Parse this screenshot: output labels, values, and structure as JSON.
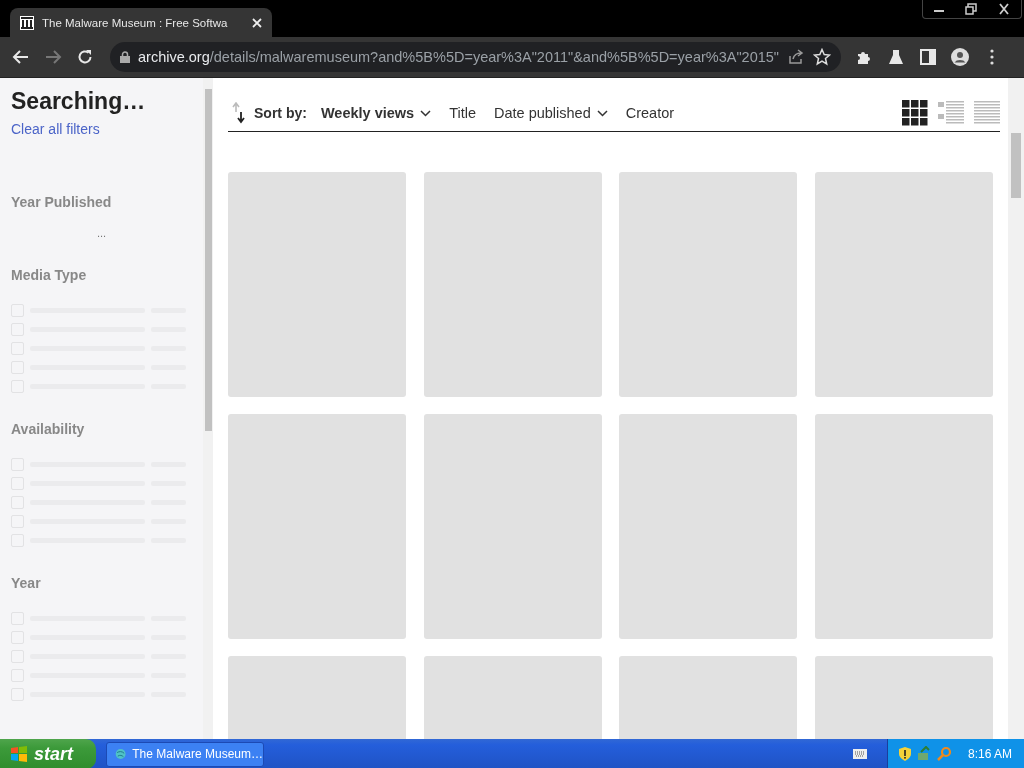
{
  "browser": {
    "tab": {
      "title": "The Malware Museum : Free Softwa",
      "selected": true
    },
    "address": {
      "host": "archive.org",
      "path": "/details/malwaremuseum?and%5B%5D=year%3A\"2011\"&and%5B%5D=year%3A\"2015\""
    }
  },
  "sidebar": {
    "heading": "Searching…",
    "clear_link": "Clear all filters",
    "facets": [
      {
        "title": "Year Published",
        "kind": "dots",
        "text": "..."
      },
      {
        "title": "Media Type",
        "kind": "rows"
      },
      {
        "title": "Availability",
        "kind": "rows"
      },
      {
        "title": "Year",
        "kind": "rows"
      }
    ]
  },
  "sort_bar": {
    "label": "Sort by:",
    "options": [
      {
        "label": "Weekly views",
        "selected": true,
        "dropdown": true
      },
      {
        "label": "Title",
        "selected": false,
        "dropdown": false
      },
      {
        "label": "Date published",
        "selected": false,
        "dropdown": true
      },
      {
        "label": "Creator",
        "selected": false,
        "dropdown": false
      }
    ],
    "views": [
      {
        "kind": "grid",
        "selected": true
      },
      {
        "kind": "list-detail",
        "selected": false
      },
      {
        "kind": "list-compact",
        "selected": false
      }
    ]
  },
  "taskbar": {
    "start": "start",
    "task": "The Malware Museum…",
    "clock": "8:16 AM"
  }
}
